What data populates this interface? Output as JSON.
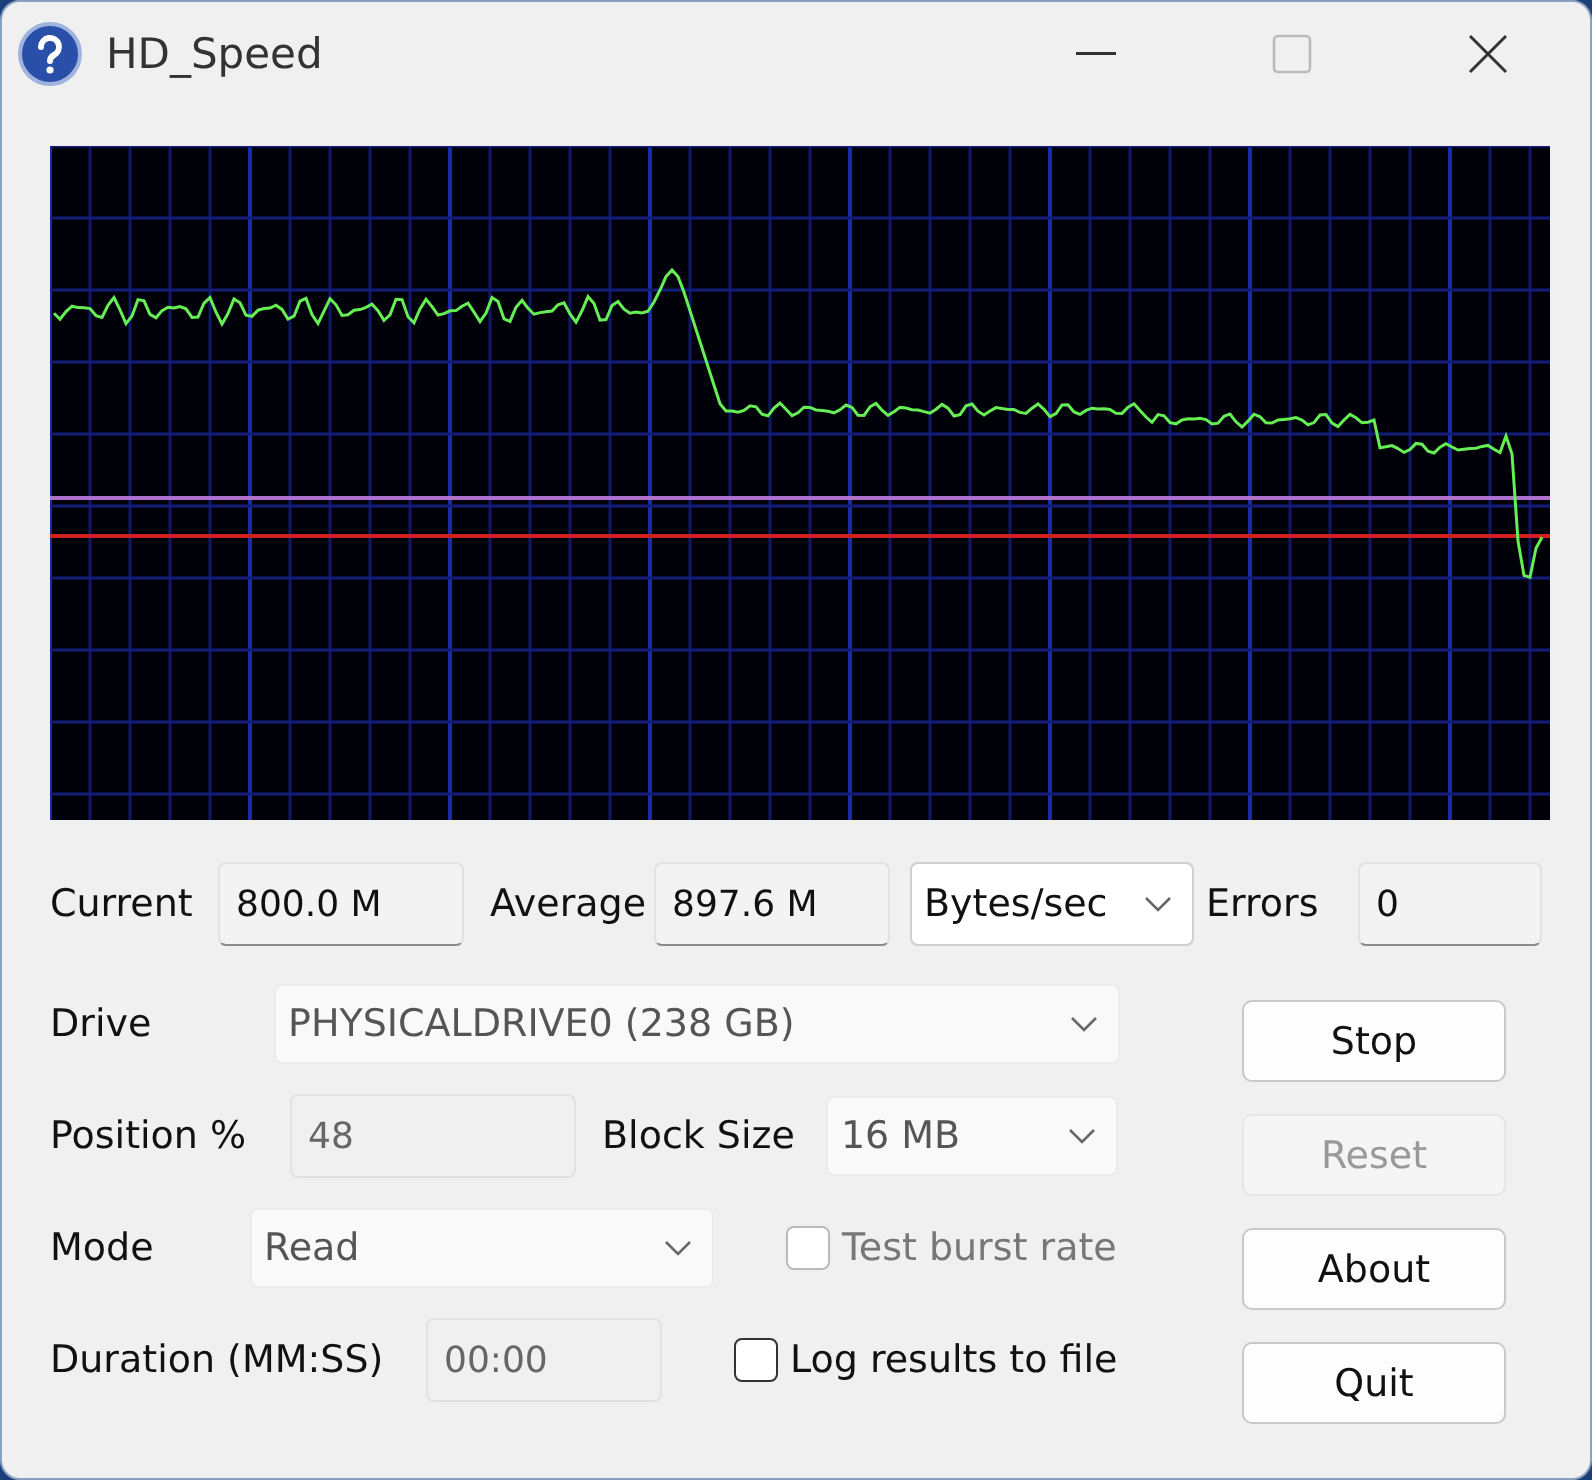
{
  "window": {
    "title": "HD_Speed"
  },
  "stats": [
    {
      "kind": "field",
      "label": "Current",
      "value": "800.0 M"
    },
    {
      "kind": "field",
      "label": "Average",
      "value": "897.6 M"
    },
    {
      "kind": "select",
      "value": "Bytes/sec"
    },
    {
      "kind": "field",
      "label": "Errors",
      "value": "0"
    }
  ],
  "rows": [
    {
      "label": "Drive",
      "kind": "select",
      "value": "PHYSICALDRIVE0 (238 GB)",
      "disabled": false
    },
    {
      "label": "Position %",
      "kind": "field",
      "value": "48",
      "disabled": true,
      "extra": {
        "label": "Block Size",
        "value": "16 MB"
      }
    },
    {
      "label": "Mode",
      "kind": "select",
      "value": "Read",
      "disabled": false,
      "checkbox": {
        "label": "Test burst rate",
        "checked": false,
        "disabled": true
      }
    },
    {
      "label": "Duration (MM:SS)",
      "kind": "field",
      "value": "00:00",
      "disabled": true,
      "checkbox": {
        "label": "Log results to file",
        "checked": false,
        "disabled": false
      }
    }
  ],
  "buttons": [
    {
      "label": "Stop",
      "disabled": false
    },
    {
      "label": "Reset",
      "disabled": true
    },
    {
      "label": "About",
      "disabled": false
    },
    {
      "label": "Quit",
      "disabled": false
    }
  ]
}
